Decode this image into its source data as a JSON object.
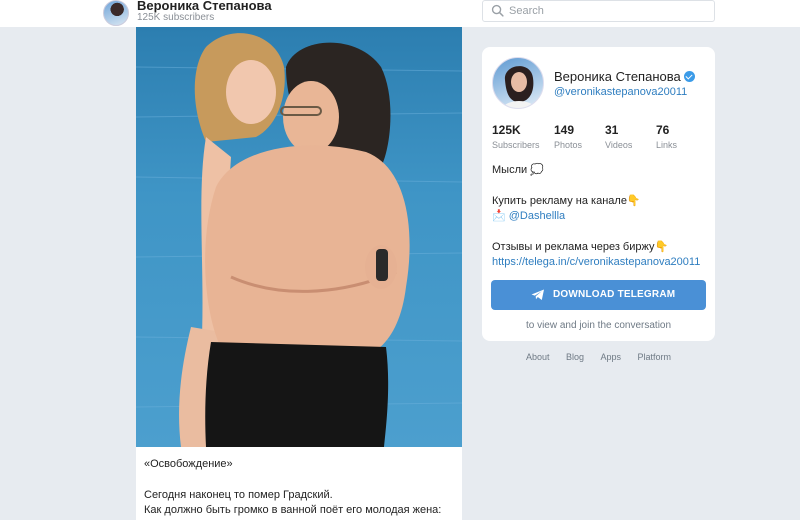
{
  "header": {
    "channel_name": "Вероника Степанова",
    "subscribers": "125K subscribers",
    "search_placeholder": "Search"
  },
  "post": {
    "photo_description_icon": "beach-couple-photo",
    "lines": [
      "«Освобождение»",
      "Сегодня наконец то помер Градский.",
      "Как должно быть громко в ванной поёт его молодая жена:"
    ]
  },
  "profile": {
    "name": "Вероника Степанова",
    "handle": "@veronikastepanova20011",
    "stats": [
      {
        "num": "125K",
        "label": "Subscribers"
      },
      {
        "num": "149",
        "label": "Photos"
      },
      {
        "num": "31",
        "label": "Videos"
      },
      {
        "num": "76",
        "label": "Links"
      }
    ],
    "about": {
      "line1": "Мысли 💭",
      "line2": "Купить рекламу на канале👇",
      "line3": "📩 @Dashellla",
      "line4": "Отзывы и реклама через биржу👇",
      "line5": "https://telega.in/c/veronikastepanova20011"
    },
    "download_label": "DOWNLOAD TELEGRAM",
    "view_note": "to view and join the conversation"
  },
  "footer": {
    "links": [
      "About",
      "Blog",
      "Apps",
      "Platform"
    ]
  },
  "colors": {
    "accent": "#4a90d6",
    "link": "#2f7ec0",
    "background": "#e7ebf0"
  }
}
